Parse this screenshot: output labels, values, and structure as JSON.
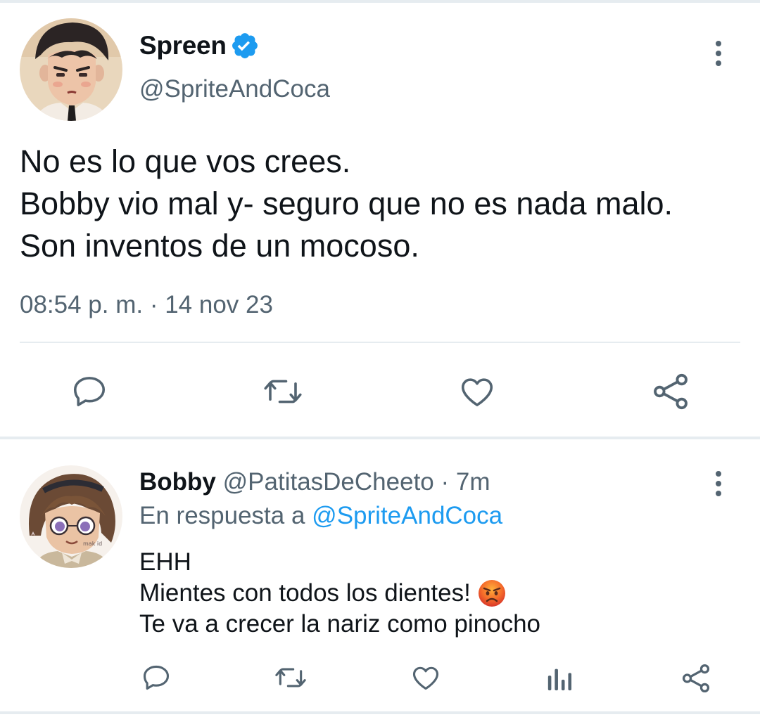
{
  "main_tweet": {
    "author": {
      "name": "Spreen",
      "handle": "@SpriteAndCoca",
      "verified": true
    },
    "text_lines": [
      "No es lo que vos crees.",
      "Bobby vio mal y- seguro que no es nada malo.",
      "Son inventos de un mocoso."
    ],
    "timestamp": "08:54 p. m. · 14 nov 23",
    "actions": [
      "reply-icon",
      "retweet-icon",
      "like-icon",
      "share-icon"
    ]
  },
  "reply_tweet": {
    "author": {
      "name": "Bobby",
      "handle": "@PatitasDeCheeto",
      "age": "· 7m"
    },
    "in_reply_to_label": "En respuesta a",
    "in_reply_to_handle": "@SpriteAndCoca",
    "text_lines": [
      "EHH",
      "Mientes con todos los dientes!",
      "Te va a crecer la nariz como pinocho"
    ],
    "emoji": "angry-face",
    "actions": [
      "reply-icon",
      "retweet-icon",
      "like-icon",
      "analytics-icon",
      "share-icon"
    ]
  },
  "colors": {
    "text": "#0f1419",
    "secondary": "#536471",
    "link": "#1d9bf0",
    "verified": "#1d9bf0",
    "divider": "#e6ecf0"
  }
}
